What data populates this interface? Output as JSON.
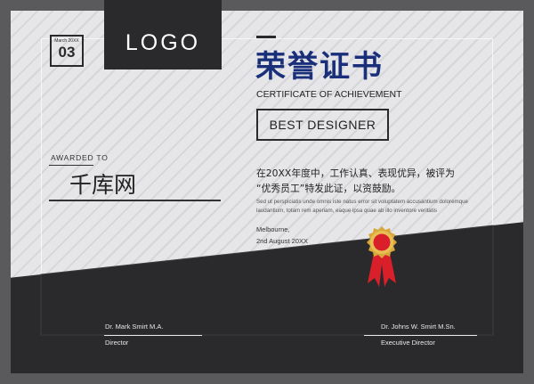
{
  "logo": {
    "text": "LOGO"
  },
  "date_box": {
    "month": "March 20XX",
    "day": "03"
  },
  "awarded": {
    "label": "AWARDED TO",
    "recipient": "千库网"
  },
  "title": {
    "cn": "荣誉证书",
    "en": "CERTIFICATE OF ACHIEVEMENT"
  },
  "badge": {
    "text": "BEST DESIGNER"
  },
  "body": {
    "cn_line1": "在20XX年度中，工作认真、表现优异，被评为",
    "cn_line2": "“优秀员工”特发此证，以资鼓励。",
    "en_line1": "Sed ut perspiciatis unde omnis iste natus error sit voluptatem accusantium doloremque",
    "en_line2": "laudantium, totam rem aperiam, eaque ipsa quae ab illo inventore veritatis"
  },
  "issue": {
    "place": "Melbourne,",
    "date": "2nd August 20XX"
  },
  "signatures": [
    {
      "name": "Dr. Mark Smirt M.A.",
      "role": "Director"
    },
    {
      "name": "Dr. Johns W. Smirt M.Sn.",
      "role": "Executive Director"
    }
  ],
  "colors": {
    "accent": "#1a2f7a",
    "dark": "#2a2a2c",
    "seal_red": "#d9202a",
    "seal_gold": "#d9a83a"
  }
}
